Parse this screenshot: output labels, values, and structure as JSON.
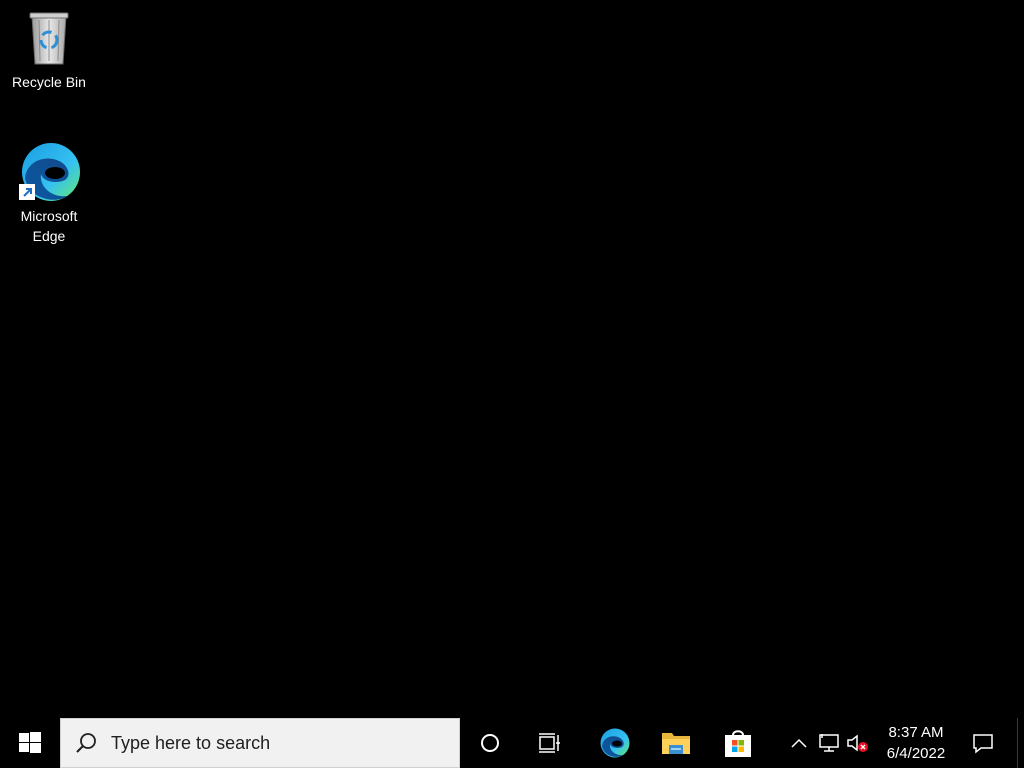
{
  "desktop": {
    "icons": [
      {
        "label": "Recycle Bin",
        "icon": "recycle-bin-icon"
      },
      {
        "label": "Microsoft\nEdge",
        "icon": "edge-icon"
      }
    ]
  },
  "taskbar": {
    "start_icon": "windows-logo-icon",
    "search": {
      "placeholder": "Type here to search",
      "icon": "search-icon"
    },
    "pinned": [
      {
        "name": "Cortana",
        "icon": "cortana-circle-icon"
      },
      {
        "name": "Task View",
        "icon": "task-view-icon"
      },
      {
        "name": "Microsoft Edge",
        "icon": "edge-icon"
      },
      {
        "name": "File Explorer",
        "icon": "folder-icon"
      },
      {
        "name": "Microsoft Store",
        "icon": "store-bag-icon"
      }
    ],
    "tray": {
      "icons": [
        "chevron-up-icon",
        "network-icon",
        "volume-muted-icon"
      ],
      "time": "8:37 AM",
      "date": "6/4/2022",
      "notification_icon": "notification-icon"
    }
  },
  "colors": {
    "background": "#000000",
    "taskbar": "#000000",
    "search_bg": "#f1f1f1",
    "text": "#ffffff",
    "mute_badge": "#e81123"
  }
}
